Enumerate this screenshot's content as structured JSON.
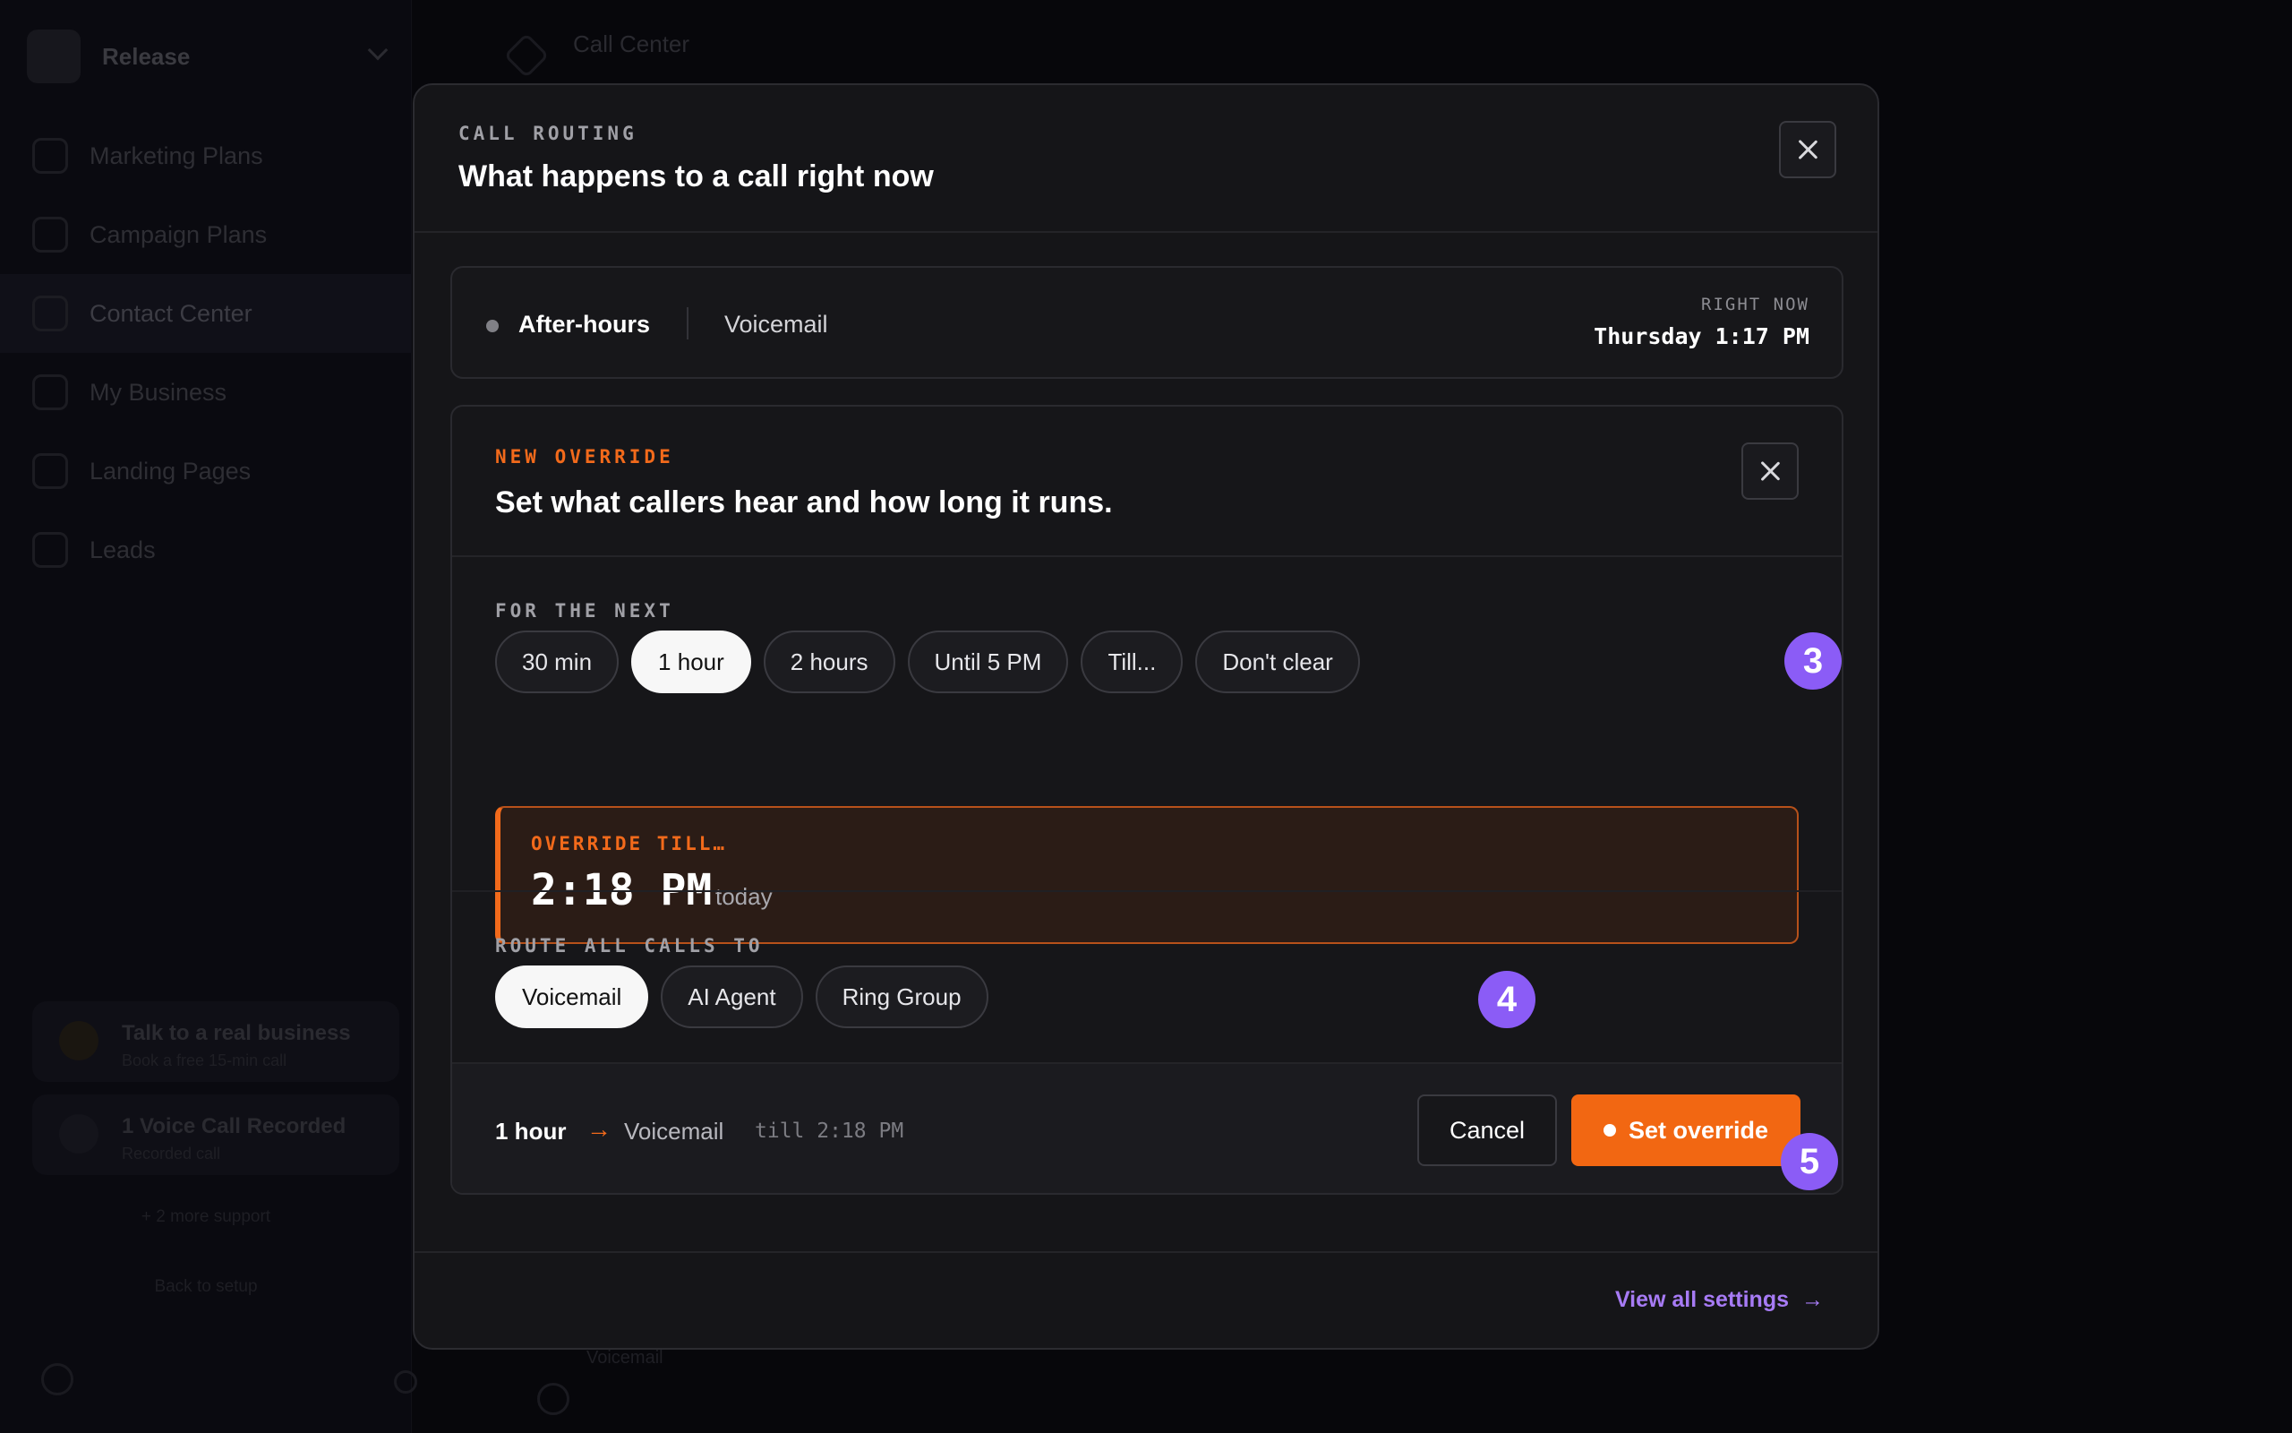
{
  "background": {
    "workspace": "Release",
    "nav": [
      "Marketing Plans",
      "Campaign Plans",
      "Contact Center",
      "My Business",
      "Landing Pages",
      "Leads"
    ],
    "cards": [
      {
        "title": "Talk to a real business",
        "subtitle": "Book a free 15-min call"
      },
      {
        "title": "1 Voice Call Recorded",
        "subtitle": "Recorded call"
      }
    ],
    "links": [
      "+ 2 more support",
      "Back to setup"
    ],
    "topbar_title": "Call Center",
    "bottom_text": "Voicemail"
  },
  "modal": {
    "eyebrow": "CALL ROUTING",
    "title": "What happens to a call right now",
    "close_icon": "close-icon"
  },
  "status": {
    "mode": "After-hours",
    "target": "Voicemail",
    "right_now_label": "RIGHT NOW",
    "right_now_time": "Thursday 1:17 PM",
    "dot_color": "#808086"
  },
  "override": {
    "eyebrow": "NEW OVERRIDE",
    "title": "Set what callers hear and how long it runs.",
    "duration": {
      "label": "FOR THE NEXT",
      "options": [
        "30 min",
        "1 hour",
        "2 hours",
        "Until 5 PM",
        "Till...",
        "Don't clear"
      ],
      "selected": "1 hour",
      "badge": "3"
    },
    "until": {
      "label": "OVERRIDE TILL…",
      "time": "2:18 PM",
      "relative": "today"
    },
    "route": {
      "label": "ROUTE ALL CALLS TO",
      "options": [
        "Voicemail",
        "AI Agent",
        "Ring Group"
      ],
      "selected": "Voicemail",
      "badge": "4"
    },
    "summary": {
      "duration": "1 hour",
      "arrow": "→",
      "target": "Voicemail",
      "till": "till 2:18 PM"
    },
    "cancel_label": "Cancel",
    "set_label": "Set override",
    "set_badge": "5"
  },
  "footer": {
    "view_all_label": "View all settings",
    "view_all_arrow": "→"
  },
  "colors": {
    "accent_orange": "#f26712",
    "badge_purple": "#8b5cf6",
    "link_purple": "#a77bf5"
  }
}
